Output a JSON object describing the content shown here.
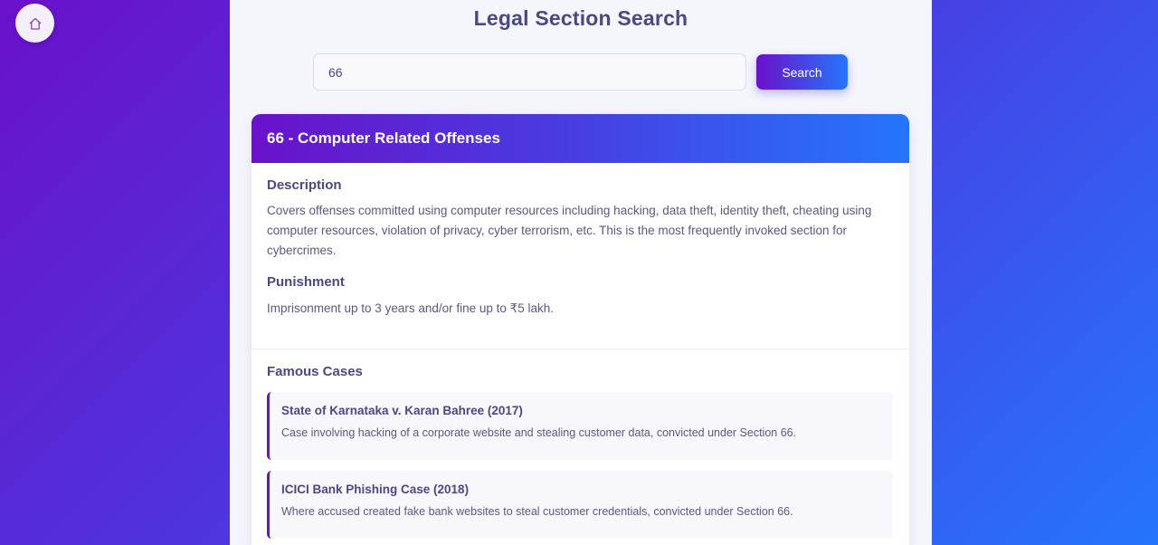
{
  "nav": {
    "home_icon": "home-icon"
  },
  "page": {
    "title": "Legal Section Search"
  },
  "search": {
    "value": "66",
    "button_label": "Search"
  },
  "result": {
    "title": "66 - Computer Related Offenses",
    "description_heading": "Description",
    "description": "Covers offenses committed using computer resources including hacking, data theft, identity theft, cheating using computer resources, violation of privacy, cyber terrorism, etc. This is the most frequently invoked section for cybercrimes.",
    "punishment_heading": "Punishment",
    "punishment": "Imprisonment up to 3 years and/or fine up to ₹5 lakh.",
    "cases_heading": "Famous Cases",
    "cases": [
      {
        "title": "State of Karnataka v. Karan Bahree (2017)",
        "description": "Case involving hacking of a corporate website and stealing customer data, convicted under Section 66."
      },
      {
        "title": "ICICI Bank Phishing Case (2018)",
        "description": "Where accused created fake bank websites to steal customer credentials, convicted under Section 66."
      }
    ]
  },
  "colors": {
    "accent_start": "#6a11cb",
    "accent_end": "#2575fc",
    "text": "#4b4885"
  }
}
